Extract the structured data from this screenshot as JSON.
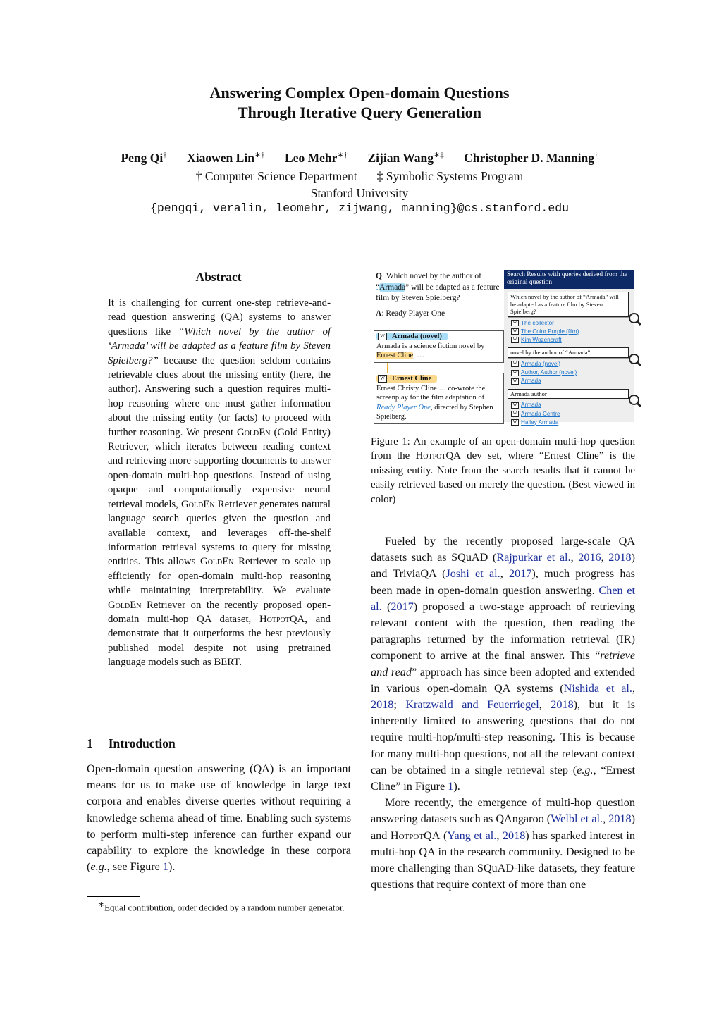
{
  "paper": {
    "title_line1": "Answering Complex Open-domain Questions",
    "title_line2": "Through Iterative Query Generation",
    "authors": [
      {
        "name": "Peng Qi",
        "marks": "†"
      },
      {
        "name": "Xiaowen Lin",
        "marks": "∗†"
      },
      {
        "name": "Leo Mehr",
        "marks": "∗†"
      },
      {
        "name": "Zijian Wang",
        "marks": "∗‡"
      },
      {
        "name": "Christopher D. Manning",
        "marks": "†"
      }
    ],
    "affiliation1": "† Computer Science Department",
    "affiliation2": "‡ Symbolic Systems Program",
    "institution": "Stanford University",
    "email": "{pengqi, veralin, leomehr, zijwang, manning}@cs.stanford.edu"
  },
  "abstract": {
    "heading": "Abstract",
    "p1_a": "It is challenging for current one-step retrieve-and-read question answering (QA) systems to answer questions like ",
    "p1_quote": "“Which novel by the author of ‘Armada’ will be adapted as a feature film by Steven Spielberg?”",
    "p1_b": " because the question seldom contains retrievable clues about the missing entity (here, the author). Answering such a question requires multi-hop reasoning where one must gather information about the missing entity (or facts) to proceed with further reasoning. We present ",
    "golden": "GoldEn",
    "p1_c": " (Gold Entity) Retriever, which iterates between reading context and retrieving more supporting documents to answer open-domain multi-hop questions. Instead of using opaque and computationally expensive neural retrieval models, ",
    "p1_d": " Retriever generates natural language search queries given the question and available context, and leverages off-the-shelf information retrieval systems to query for missing entities. This allows ",
    "p1_e": " Retriever to scale up efficiently for open-domain multi-hop reasoning while maintaining interpretability. We evaluate ",
    "p1_f": " Retriever on the recently proposed open-domain multi-hop QA dataset, ",
    "hotpot": "HotpotQA",
    "p1_g": ", and demonstrate that it outperforms the best previously published model despite not using pretrained language models such as BERT."
  },
  "intro": {
    "number": "1",
    "heading": "Introduction",
    "p1_a": "Open-domain question answering (QA) is an important means for us to make use of knowledge in large text corpora and enables diverse queries without requiring a knowledge schema ahead of time. Enabling such systems to perform multi-step inference can further expand our capability to explore the knowledge in these corpora (",
    "eg": "e.g.",
    "p1_b": ", see Figure ",
    "fig_ref": "1",
    "p1_c": ").",
    "footnote_mark": "∗",
    "footnote": "Equal contribution, order decided by a random number generator."
  },
  "figure": {
    "q_label": "Q",
    "q_text_a": ": Which novel by the author of “",
    "q_entity": "Armada",
    "q_text_b": "” will be adapted as a feature film by Steven Spielberg?",
    "a_label": "A",
    "a_text": ": Ready Player One",
    "para1_title": "Armada (novel)",
    "para1_text_a": "Armada is a science fiction novel by ",
    "para1_entity": "Ernest Cline",
    "para1_text_b": ", …",
    "para2_title": "Ernest Cline",
    "para2_text_a": "Ernest Christy Cline … co-wrote the screenplay for the film adaptation of ",
    "para2_link": "Ready Player One",
    "para2_text_b": ", directed by Stephen Spielberg.",
    "wiki_glyph": "W",
    "panel_header": "Search Results with queries derived from the original question",
    "queries": [
      {
        "query": "Which novel by the author of “Armada” will be adapted as a feature film by Steven Spielberg?",
        "results": [
          "The collector",
          "The Color Purple (film)",
          "Kim Wozencraft"
        ]
      },
      {
        "query": "novel by the author of “Armada”",
        "results": [
          "Armada (novel)",
          "Author, Author (novel)",
          "Armada"
        ]
      },
      {
        "query": "Armada author",
        "results": [
          "Armada",
          "Armada Centre",
          "Halley Armada"
        ]
      }
    ],
    "caption_a": "Figure 1:  An example of an open-domain multi-hop question from the ",
    "caption_hotpot": "HotpotQA",
    "caption_b": " dev set, where “Ernest Cline” is the missing entity. Note from the search results that it cannot be easily retrieved based on merely the question. (Best viewed in color)",
    "colors": {
      "entity1": "#a9dcf5",
      "entity2": "#fbd98f",
      "panel_header": "#0d2a66",
      "link": "#1a73c9"
    }
  },
  "right_col": {
    "p2_a": "Fueled by the recently proposed large-scale QA datasets such as SQuAD (",
    "c_rajpurkar": "Rajpurkar et al.",
    "c_2016": "2016",
    "c_2018a": "2018",
    "p2_b": ") and TriviaQA (",
    "c_joshi": "Joshi et al.",
    "c_2017a": "2017",
    "p2_c": "), much progress has been made in open-domain question answering. ",
    "c_chen": "Chen et al.",
    "c_2017b": "2017",
    "p2_d": " proposed a two-stage approach of retrieving relevant content with the question, then reading the paragraphs returned by the information retrieval (IR) component to arrive at the final answer. This “",
    "retrieve_read": "retrieve and read",
    "p2_e": "” approach has since been adopted and extended in various open-domain QA systems (",
    "c_nishida": "Nishida et al.",
    "c_2018b": "2018",
    "c_kratzwald": "Kratzwald and Feuerriegel",
    "c_2018c": "2018",
    "p2_f": "), but it is inherently limited to answering questions that do not require multi-hop/multi-step reasoning. This is because for many multi-hop questions, not all the relevant context can be obtained in a single retrieval step (",
    "eg": "e.g.",
    "p2_g": ", “Ernest Cline” in Figure ",
    "fig_ref": "1",
    "p2_h": ").",
    "p3_a": "More recently, the emergence of multi-hop question answering datasets such as QAngaroo (",
    "c_welbl": "Welbl et al.",
    "c_2018d": "2018",
    "p3_b": ") and ",
    "hotpot": "HotpotQA",
    "p3_c": " (",
    "c_yang": "Yang et al.",
    "c_2018e": "2018",
    "p3_d": ") has sparked interest in multi-hop QA in the research community. Designed to be more challenging than SQuAD-like datasets, they feature questions that require context of more than one"
  }
}
